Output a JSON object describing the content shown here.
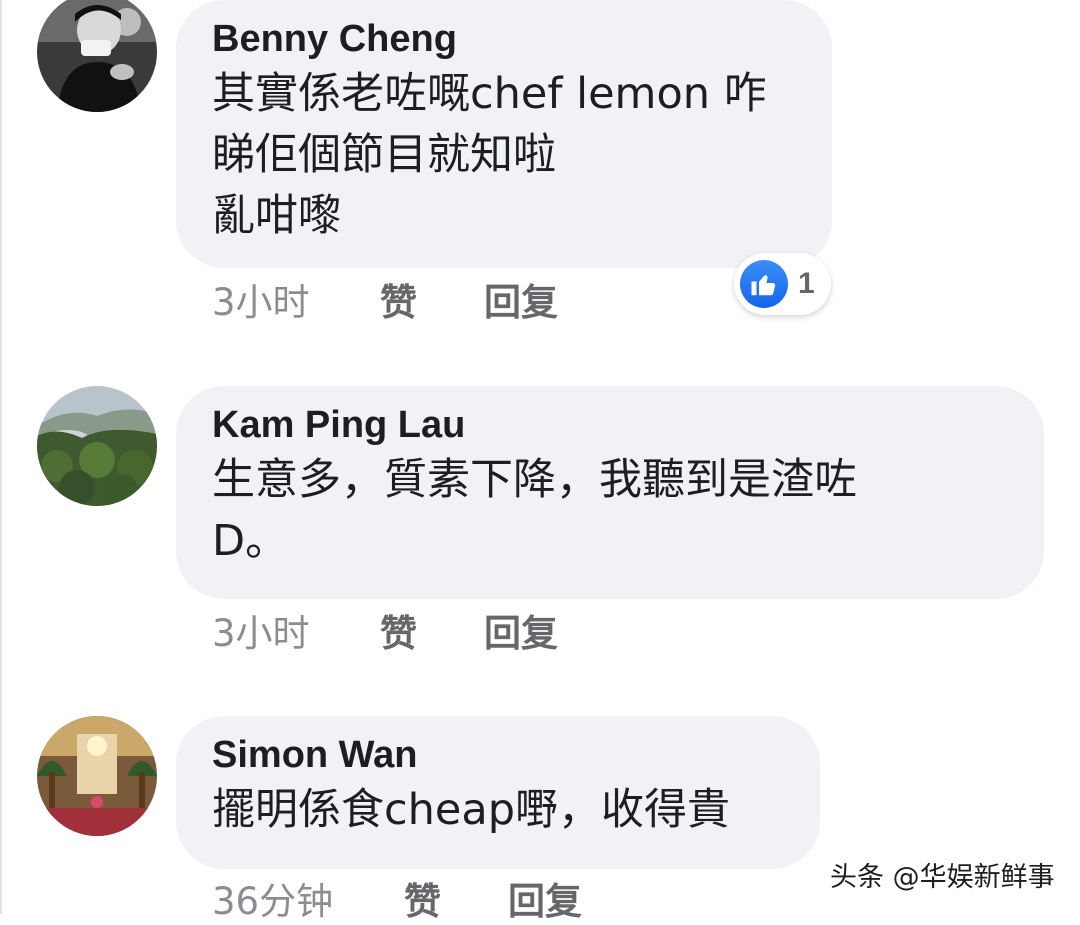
{
  "comments": [
    {
      "author": "Benny Cheng",
      "text": "其實係老咗嘅chef lemon 咋\n睇佢個節目就知啦\n亂咁嚟",
      "time": "3小时",
      "like_label": "赞",
      "reply_label": "回复",
      "reaction": {
        "icon": "thumbs-up-icon",
        "count": "1"
      },
      "avatar_icon": "person-drinking-avatar"
    },
    {
      "author": "Kam Ping Lau",
      "text": "生意多，質素下降，我聽到是渣咗\nD。",
      "time": "3小时",
      "like_label": "赞",
      "reply_label": "回复",
      "avatar_icon": "landscape-avatar"
    },
    {
      "author": "Simon Wan",
      "text": "擺明係食cheap嘢，收得貴",
      "time": "36分钟",
      "like_label": "赞",
      "reply_label": "回复",
      "avatar_icon": "hotel-lobby-avatar"
    }
  ],
  "watermark": "头条 @华娱新鲜事",
  "colors": {
    "bubble": "#f0f2f5",
    "author": "#1c1e21",
    "meta": "#8a8d91",
    "action": "#65676b",
    "like": "#1877f2"
  }
}
